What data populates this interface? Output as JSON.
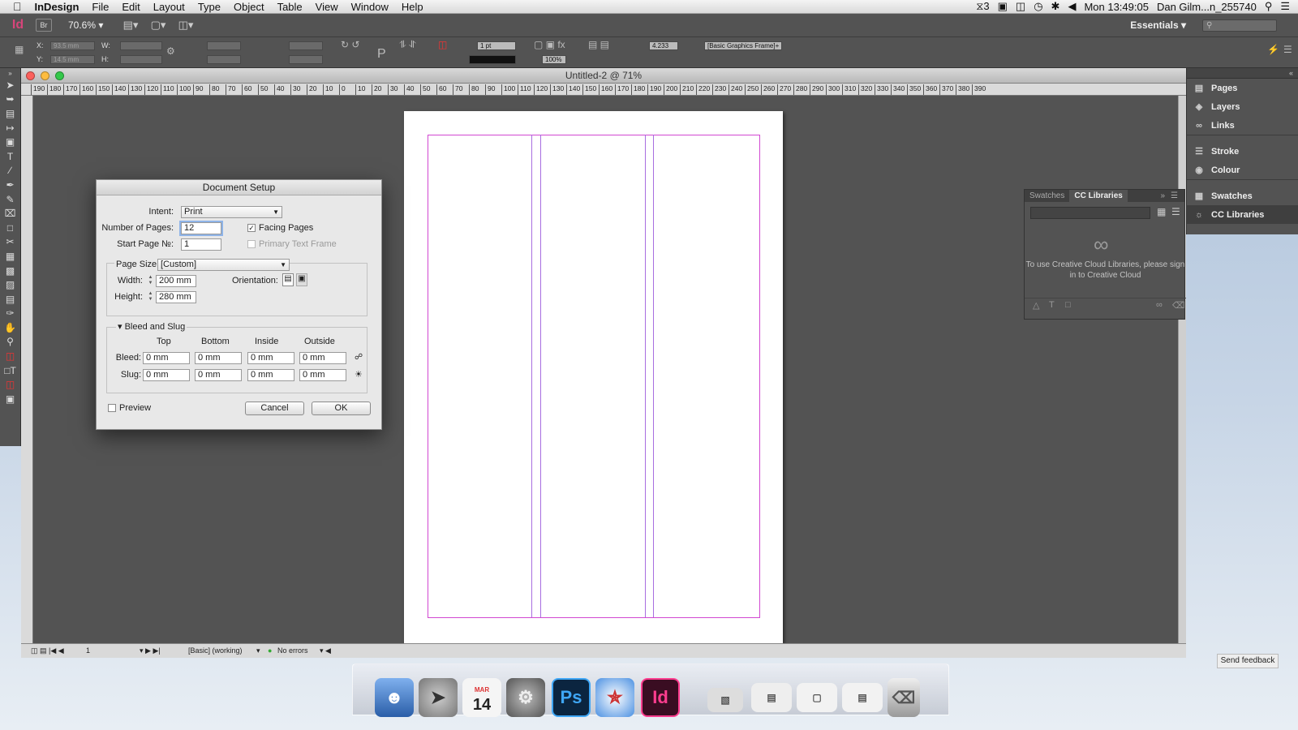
{
  "menubar": {
    "app": "InDesign",
    "items": [
      "File",
      "Edit",
      "Layout",
      "Type",
      "Object",
      "Table",
      "View",
      "Window",
      "Help"
    ],
    "adobe_count": "3",
    "clock": "Mon 13:49:05",
    "user": "Dan Gilm...n_255740"
  },
  "appbar": {
    "logo": "Id",
    "bridge": "Br",
    "zoom": "70.6%",
    "workspace": "Essentials"
  },
  "control": {
    "x": "93.5 mm",
    "y": "14.5 mm",
    "w_label": "W:",
    "h_label": "H:",
    "x_label": "X:",
    "y_label": "Y:",
    "stroke": "1 pt",
    "opacity": "100%",
    "size": "4.233 mm",
    "style": "[Basic Graphics Frame]+"
  },
  "document": {
    "title": "Untitled-2 @ 71%",
    "ruler_ticks": [
      "190",
      "180",
      "170",
      "160",
      "150",
      "140",
      "130",
      "120",
      "110",
      "100",
      "90",
      "80",
      "70",
      "60",
      "50",
      "40",
      "30",
      "20",
      "10",
      "0",
      "10",
      "20",
      "30",
      "40",
      "50",
      "60",
      "70",
      "80",
      "90",
      "100",
      "110",
      "120",
      "130",
      "140",
      "150",
      "160",
      "170",
      "180",
      "190",
      "200",
      "210",
      "220",
      "230",
      "240",
      "250",
      "260",
      "270",
      "280",
      "290",
      "300",
      "310",
      "320",
      "330",
      "340",
      "350",
      "360",
      "370",
      "380",
      "390"
    ]
  },
  "status": {
    "page": "1",
    "mode": "[Basic] (working)",
    "preflight": "No errors"
  },
  "dialog": {
    "title": "Document Setup",
    "intent_label": "Intent:",
    "intent": "Print",
    "pages_label": "Number of Pages:",
    "pages": "12",
    "facing": "Facing Pages",
    "start_label": "Start Page №:",
    "start": "1",
    "primary": "Primary Text Frame",
    "page_size_label": "Page Size:",
    "page_size": "[Custom]",
    "width_label": "Width:",
    "width": "200 mm",
    "height_label": "Height:",
    "height": "280 mm",
    "orientation_label": "Orientation:",
    "bleed_title": "Bleed and Slug",
    "cols": [
      "Top",
      "Bottom",
      "Inside",
      "Outside"
    ],
    "bleed_label": "Bleed:",
    "bleed": [
      "0 mm",
      "0 mm",
      "0 mm",
      "0 mm"
    ],
    "slug_label": "Slug:",
    "slug": [
      "0 mm",
      "0 mm",
      "0 mm",
      "0 mm"
    ],
    "preview": "Preview",
    "cancel": "Cancel",
    "ok": "OK"
  },
  "panels": {
    "items": [
      "Pages",
      "Layers",
      "Links",
      "Stroke",
      "Colour",
      "Swatches",
      "CC Libraries"
    ],
    "cc_tabs": [
      "Swatches",
      "CC Libraries"
    ],
    "cc_message": "To use Creative Cloud Libraries, please sign in to Creative Cloud"
  },
  "dock": {
    "calendar_month": "MAR",
    "calendar_day": "14"
  },
  "feedback": "Send feedback"
}
